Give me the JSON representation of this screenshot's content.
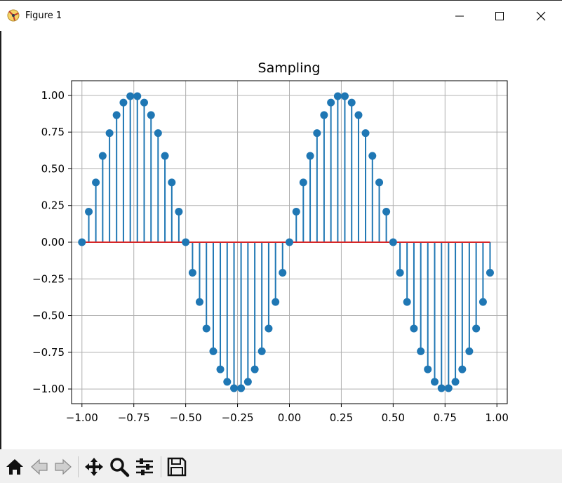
{
  "window": {
    "title": "Figure 1",
    "controls": [
      "minimize",
      "maximize",
      "close"
    ]
  },
  "toolbar": {
    "buttons": [
      "home-icon",
      "back-icon",
      "forward-icon",
      "pan-icon",
      "zoom-icon",
      "configure-subplots-icon",
      "save-icon"
    ]
  },
  "colors": {
    "stem": "#1f77b4",
    "baseline": "#d62728",
    "grid": "#b0b0b0",
    "toolbar_bg": "#f0f0f0"
  },
  "chart_data": {
    "type": "scatter",
    "style": "stem",
    "title": "Sampling",
    "xlabel": "",
    "ylabel": "",
    "xlim": [
      -1.05,
      1.05
    ],
    "ylim": [
      -1.1,
      1.1
    ],
    "grid": true,
    "legend": "none",
    "baseline_y": 0,
    "xticks": [
      -1.0,
      -0.75,
      -0.5,
      -0.25,
      0.0,
      0.25,
      0.5,
      0.75,
      1.0
    ],
    "xtick_labels": [
      "−1.00",
      "−0.75",
      "−0.50",
      "−0.25",
      "0.00",
      "0.25",
      "0.50",
      "0.75",
      "1.00"
    ],
    "yticks": [
      1.0,
      0.75,
      0.5,
      0.25,
      0.0,
      -0.25,
      -0.5,
      -0.75,
      -1.0
    ],
    "ytick_labels": [
      "1.00",
      "0.75",
      "0.50",
      "0.25",
      "0.00",
      "−0.25",
      "−0.50",
      "−0.75",
      "−1.00"
    ],
    "series": [
      {
        "x": [
          -1.0,
          -0.967,
          -0.933,
          -0.9,
          -0.867,
          -0.833,
          -0.8,
          -0.767,
          -0.733,
          -0.7,
          -0.667,
          -0.633,
          -0.6,
          -0.567,
          -0.533,
          -0.5,
          -0.467,
          -0.433,
          -0.4,
          -0.367,
          -0.333,
          -0.3,
          -0.267,
          -0.233,
          -0.2,
          -0.167,
          -0.133,
          -0.1,
          -0.067,
          -0.033,
          0.0,
          0.033,
          0.067,
          0.1,
          0.133,
          0.167,
          0.2,
          0.233,
          0.267,
          0.3,
          0.333,
          0.367,
          0.4,
          0.433,
          0.467,
          0.5,
          0.533,
          0.567,
          0.6,
          0.633,
          0.667,
          0.7,
          0.733,
          0.767,
          0.8,
          0.833,
          0.867,
          0.9,
          0.933,
          0.967
        ],
        "values": [
          0.0,
          0.208,
          0.407,
          0.588,
          0.743,
          0.866,
          0.951,
          0.995,
          0.995,
          0.951,
          0.866,
          0.743,
          0.588,
          0.407,
          0.208,
          0.0,
          -0.208,
          -0.407,
          -0.588,
          -0.743,
          -0.866,
          -0.951,
          -0.995,
          -0.995,
          -0.951,
          -0.866,
          -0.743,
          -0.588,
          -0.407,
          -0.208,
          0.0,
          0.208,
          0.407,
          0.588,
          0.743,
          0.866,
          0.951,
          0.995,
          0.995,
          0.951,
          0.866,
          0.743,
          0.588,
          0.407,
          0.208,
          0.0,
          -0.208,
          -0.407,
          -0.588,
          -0.743,
          -0.866,
          -0.951,
          -0.995,
          -0.995,
          -0.951,
          -0.866,
          -0.743,
          -0.588,
          -0.407,
          -0.208
        ]
      }
    ]
  }
}
